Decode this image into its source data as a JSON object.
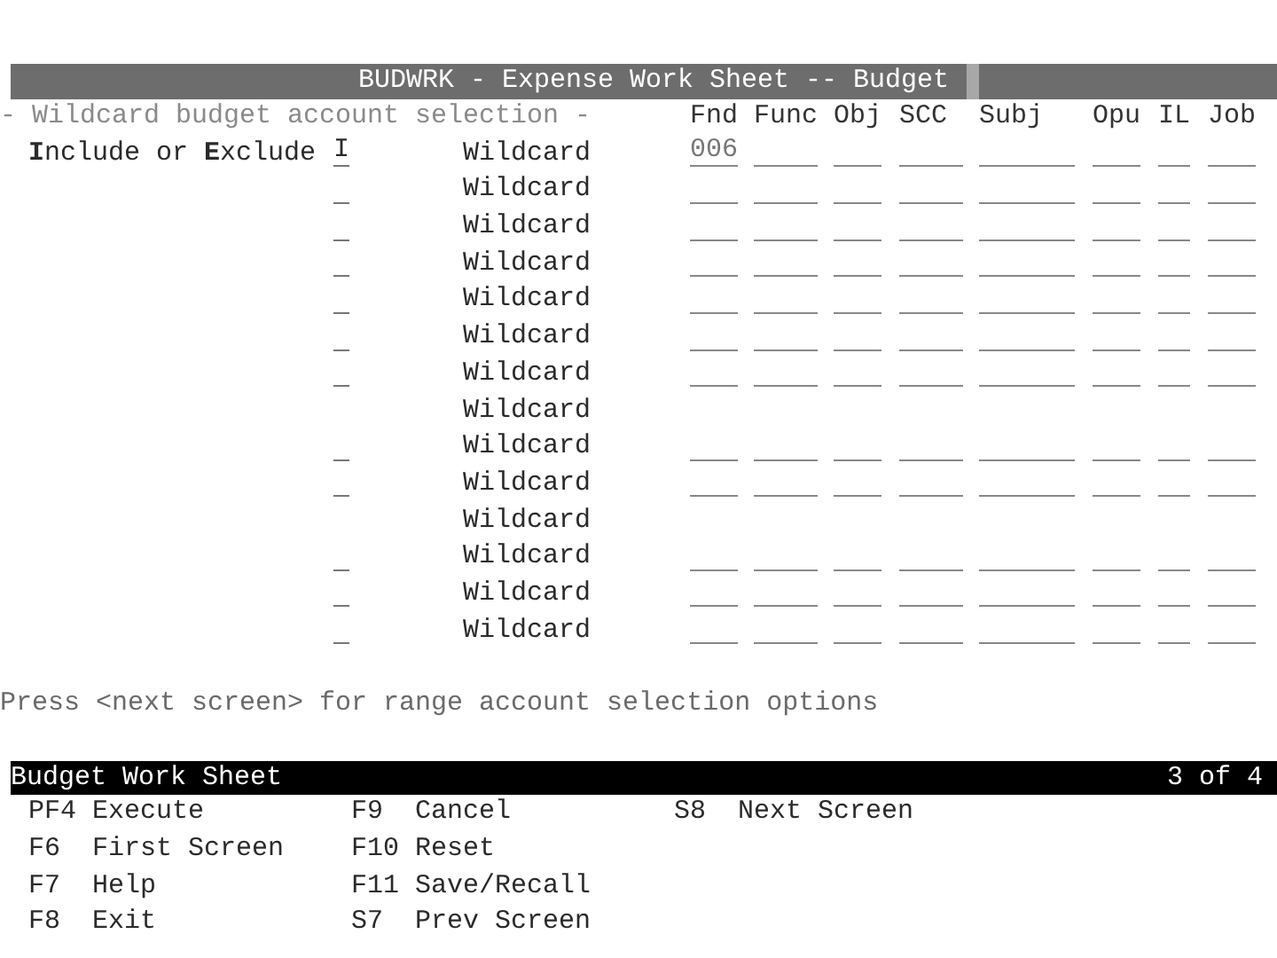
{
  "title_bar": {
    "title": "BUDWRK - Expense Work Sheet -- Budget"
  },
  "section_heading": "- Wildcard budget account selection -",
  "columns": [
    "Fnd",
    "Func",
    "Obj",
    "SCC",
    "Subj",
    "Opu",
    "IL",
    "Job"
  ],
  "rows": [
    {
      "kind": "entry",
      "label": "**I**nclude or **E**xclude",
      "code": "I",
      "wildcard": "Wildcard",
      "fnd": "006"
    },
    {
      "kind": "entry",
      "wildcard": "Wildcard"
    },
    {
      "kind": "entry",
      "wildcard": "Wildcard"
    },
    {
      "kind": "entry",
      "wildcard": "Wildcard"
    },
    {
      "kind": "entry",
      "wildcard": "Wildcard"
    },
    {
      "kind": "entry",
      "wildcard": "Wildcard"
    },
    {
      "kind": "entry",
      "wildcard": "Wildcard"
    },
    {
      "kind": "label_only",
      "wildcard": "Wildcard"
    },
    {
      "kind": "entry",
      "wildcard": "Wildcard"
    },
    {
      "kind": "entry",
      "wildcard": "Wildcard"
    },
    {
      "kind": "label_only",
      "wildcard": "Wildcard"
    },
    {
      "kind": "entry",
      "wildcard": "Wildcard"
    },
    {
      "kind": "entry",
      "wildcard": "Wildcard"
    },
    {
      "kind": "entry",
      "wildcard": "Wildcard"
    }
  ],
  "hint": "Press <next screen> for range account selection options",
  "status_bar": {
    "title": "Budget Work Sheet",
    "page": "3 of 4"
  },
  "function_key_columns": [
    [
      {
        "key": "PF4",
        "action": "Execute"
      },
      {
        "key": "F6",
        "action": "First Screen"
      },
      {
        "key": "F7",
        "action": "Help"
      },
      {
        "key": "F8",
        "action": "Exit"
      }
    ],
    [
      {
        "key": "F9",
        "action": "Cancel"
      },
      {
        "key": "F10",
        "action": "Reset"
      },
      {
        "key": "F11",
        "action": "Save/Recall"
      },
      {
        "key": "S7",
        "action": "Prev Screen"
      }
    ],
    [
      {
        "key": "S8",
        "action": "Next Screen"
      }
    ]
  ]
}
